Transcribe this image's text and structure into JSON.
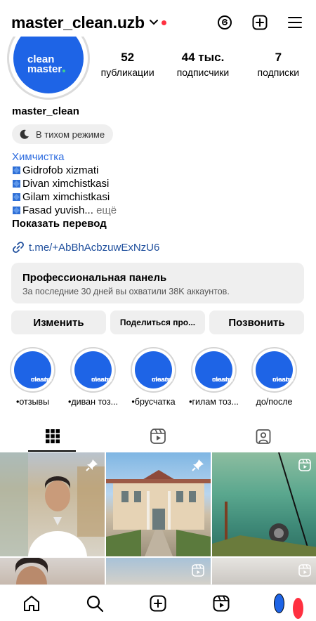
{
  "header": {
    "username": "master_clean.uzb",
    "icons": [
      "threads-icon",
      "plus-square-icon",
      "menu-icon"
    ]
  },
  "avatar": {
    "logo_line1": "clean",
    "logo_line2": "master"
  },
  "stats": [
    {
      "value": "52",
      "label": "публикации"
    },
    {
      "value": "44 тыс.",
      "label": "подписчики"
    },
    {
      "value": "7",
      "label": "подписки"
    }
  ],
  "profile": {
    "name": "master_clean",
    "quiet_mode": "В тихом режиме",
    "category": "Химчистка",
    "bio_lines": [
      "Gidrofob xizmati",
      "Divan ximchistkasi",
      "Gilam ximchistkasi",
      "Fasad yuvish..."
    ],
    "more": "ещё",
    "translate": "Показать перевод",
    "link": "t.me/+AbBhAcbzuwExNzU6"
  },
  "panel": {
    "title": "Профессиональная панель",
    "subtitle": "За последние 30 дней вы охватили 38K аккаунтов."
  },
  "buttons": {
    "edit": "Изменить",
    "share": "Поделиться про...",
    "call": "Позвонить"
  },
  "highlights": [
    {
      "label": "•отзывы"
    },
    {
      "label": "•диван тоз..."
    },
    {
      "label": "•брусчатка"
    },
    {
      "label": "•гилам тоз..."
    },
    {
      "label": "до/после"
    }
  ],
  "highlight_logo": {
    "line1": "clean",
    "line2": "master"
  },
  "colors": {
    "brand_blue": "#1e64e6",
    "link_blue": "#1e4e9c",
    "notification_red": "#ff3040"
  }
}
